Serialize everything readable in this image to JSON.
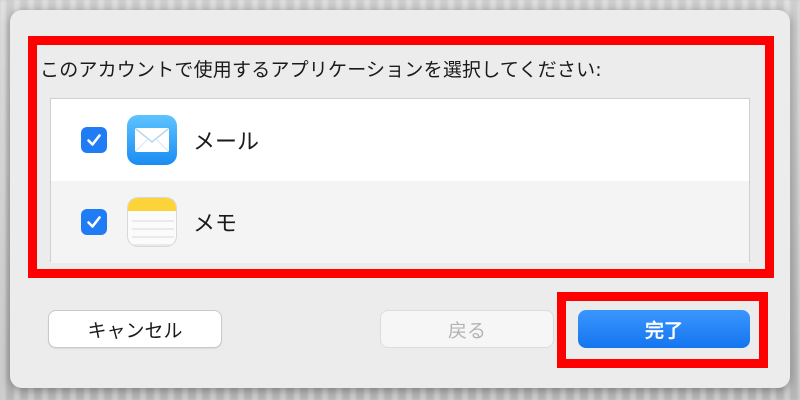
{
  "dialog": {
    "prompt": "このアカウントで使用するアプリケーションを選択してください:",
    "apps": [
      {
        "label": "メール",
        "icon": "mail-app-icon",
        "checked": true
      },
      {
        "label": "メモ",
        "icon": "notes-app-icon",
        "checked": true
      }
    ]
  },
  "buttons": {
    "cancel": "キャンセル",
    "back": "戻る",
    "done": "完了"
  },
  "colors": {
    "accent": "#1f7cf5",
    "highlight": "#ff0000"
  }
}
